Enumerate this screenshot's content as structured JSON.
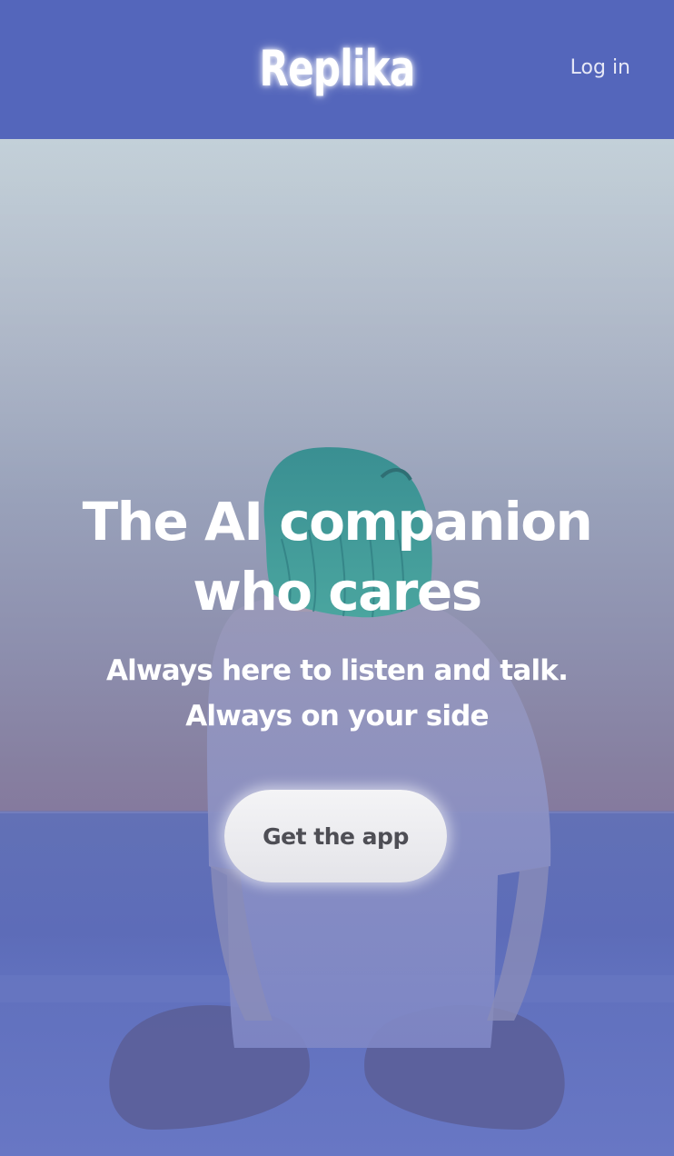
{
  "header": {
    "logo_text": "Replika",
    "login_label": "Log in"
  },
  "hero": {
    "headline_line1": "The AI companion",
    "headline_line2": "who cares",
    "subhead_line1": "Always here to listen and talk.",
    "subhead_line2": "Always on your side",
    "cta_label": "Get the app"
  },
  "colors": {
    "header_bg": "#5466bb",
    "cta_bg": "#eeeef1",
    "cta_text": "#4e4e55",
    "hair": "#3f9a98",
    "text": "#ffffff"
  }
}
